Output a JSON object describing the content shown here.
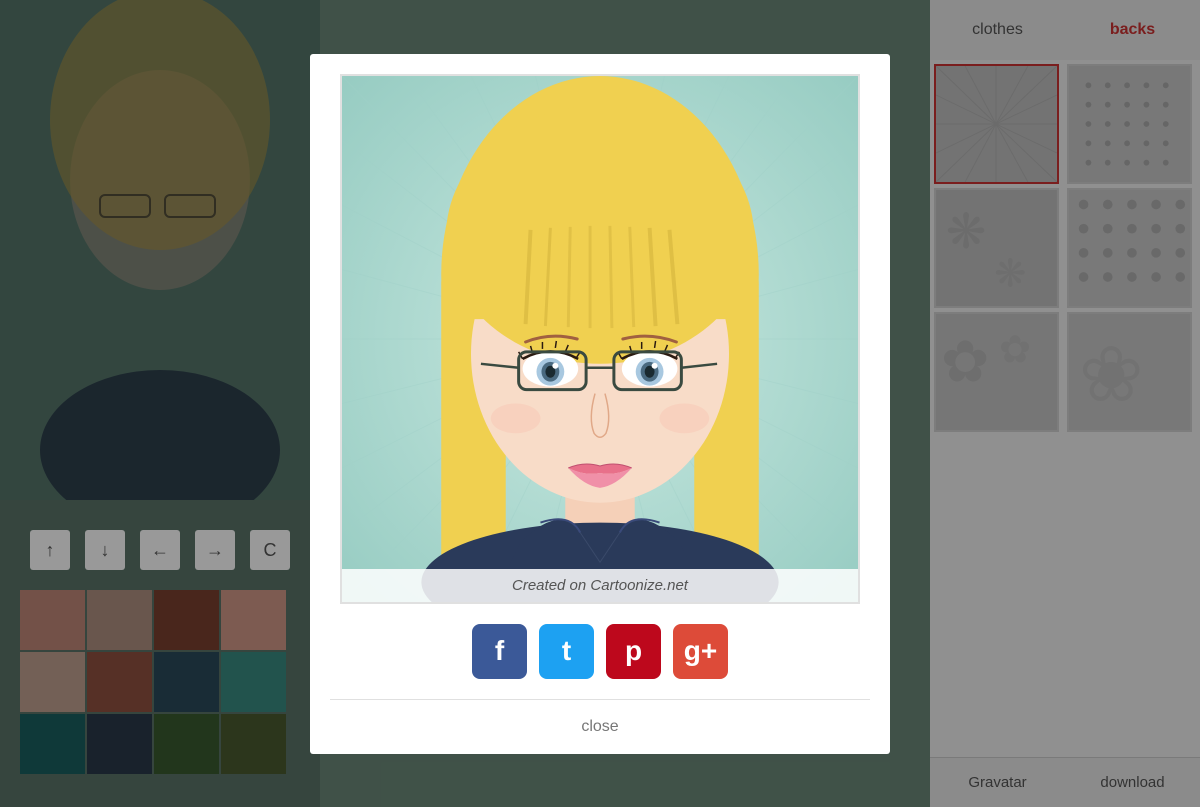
{
  "tabs": {
    "clothes": "clothes",
    "backs": "backs"
  },
  "modal": {
    "watermark": "Created on Cartoonize.net",
    "close_label": "close"
  },
  "social": {
    "facebook_label": "f",
    "twitter_label": "t",
    "pinterest_label": "p",
    "google_label": "g+"
  },
  "bottom_buttons": {
    "gravatar": "Gravatar",
    "download": "download"
  },
  "nav_buttons": {
    "up": "↑",
    "down": "↓",
    "left": "←",
    "right": "→",
    "extra": "C"
  },
  "colors": {
    "palette": [
      "#c08878",
      "#b09080",
      "#7a4030",
      "#d09888",
      "#c0a090",
      "#905040",
      "#2a4a5a",
      "#3a8a80",
      "#1a6060",
      "#2a3a4a",
      "#3a5a30",
      "#4a5a30"
    ]
  }
}
